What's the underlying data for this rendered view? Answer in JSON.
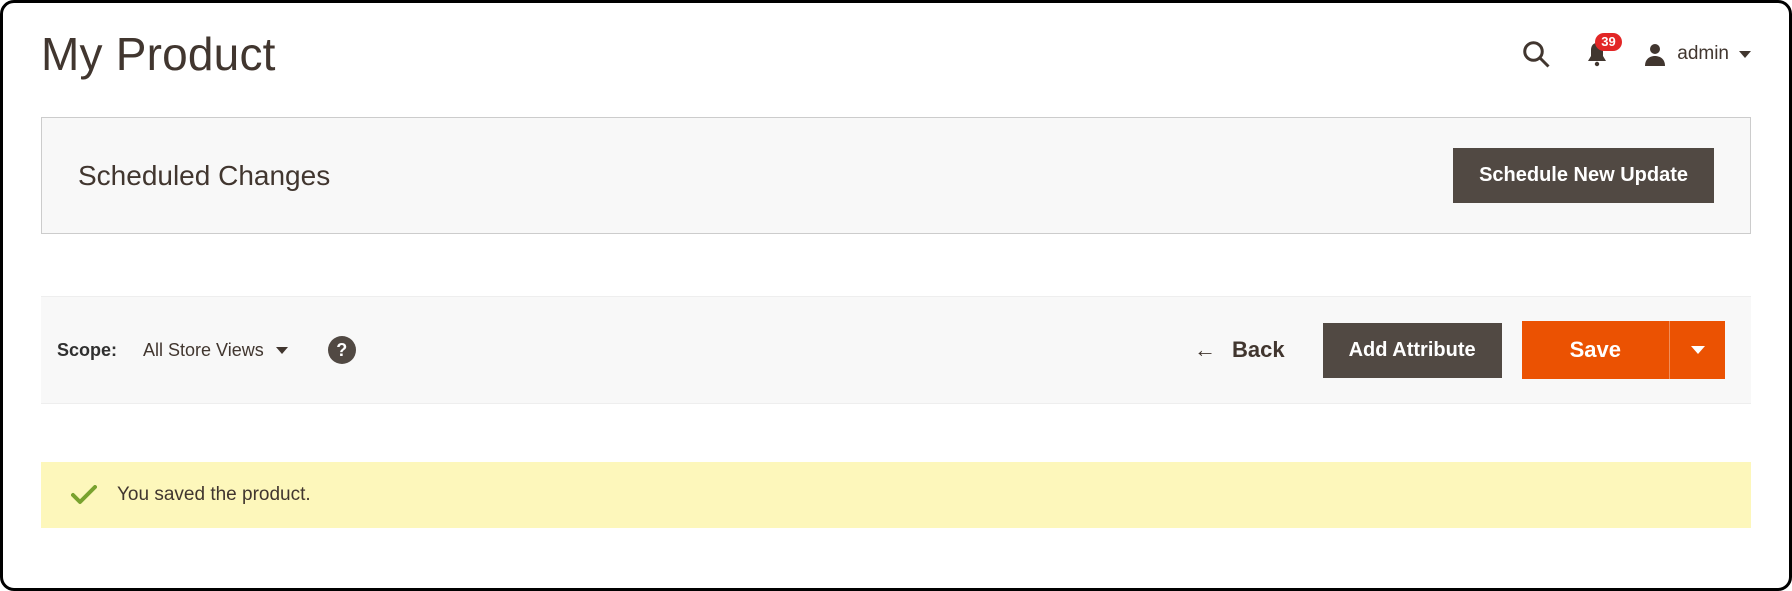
{
  "header": {
    "page_title": "My Product",
    "notification_count": "39",
    "user_name": "admin"
  },
  "scheduled": {
    "title": "Scheduled Changes",
    "new_update_button": "Schedule New Update"
  },
  "toolbar": {
    "scope_label": "Scope:",
    "scope_value": "All Store Views",
    "back_label": "Back",
    "add_attribute_label": "Add Attribute",
    "save_label": "Save"
  },
  "message": {
    "text": "You saved the product."
  }
}
